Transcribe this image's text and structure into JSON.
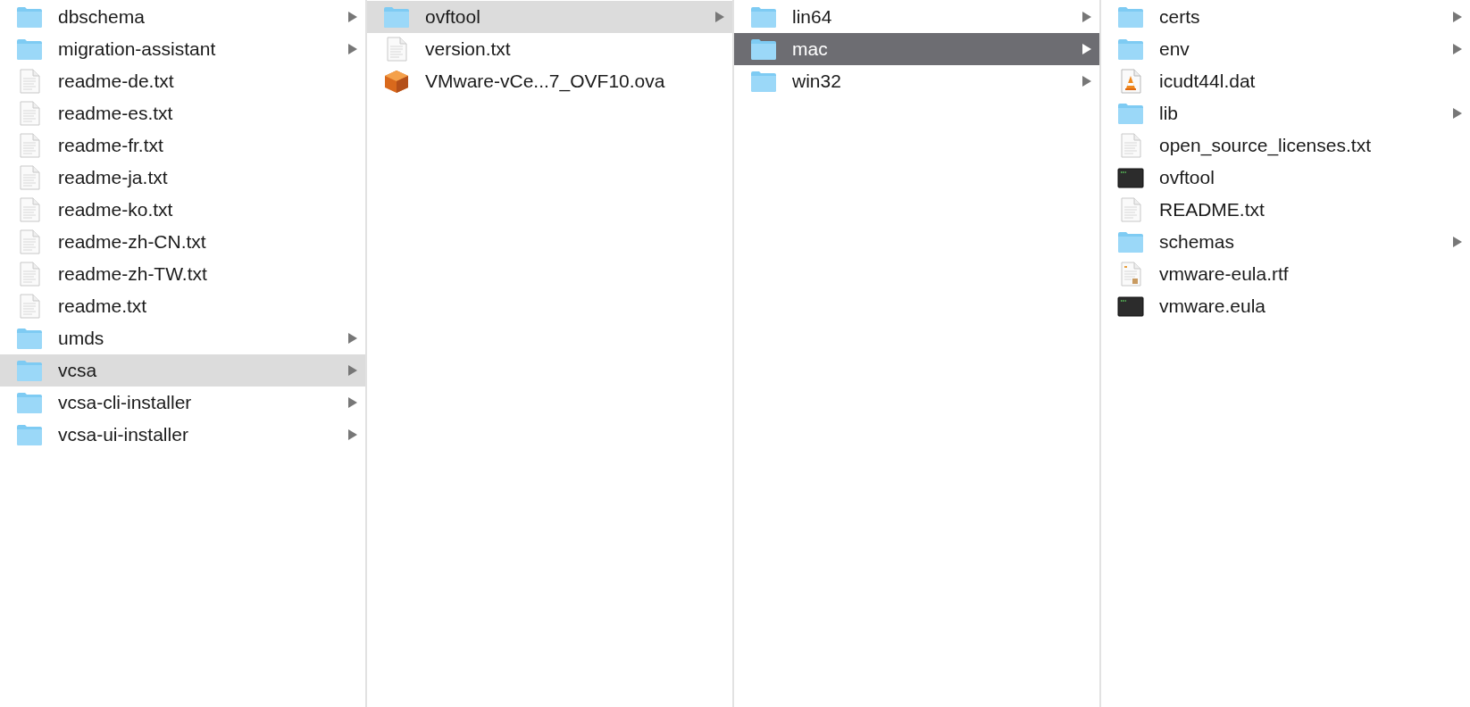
{
  "columns": [
    {
      "items": [
        {
          "name": "dbschema",
          "kind": "folder",
          "selected": false,
          "focused": false
        },
        {
          "name": "migration-assistant",
          "kind": "folder",
          "selected": false,
          "focused": false
        },
        {
          "name": "readme-de.txt",
          "kind": "text",
          "selected": false,
          "focused": false
        },
        {
          "name": "readme-es.txt",
          "kind": "text",
          "selected": false,
          "focused": false
        },
        {
          "name": "readme-fr.txt",
          "kind": "text",
          "selected": false,
          "focused": false
        },
        {
          "name": "readme-ja.txt",
          "kind": "text",
          "selected": false,
          "focused": false
        },
        {
          "name": "readme-ko.txt",
          "kind": "text",
          "selected": false,
          "focused": false
        },
        {
          "name": "readme-zh-CN.txt",
          "kind": "text",
          "selected": false,
          "focused": false
        },
        {
          "name": "readme-zh-TW.txt",
          "kind": "text",
          "selected": false,
          "focused": false
        },
        {
          "name": "readme.txt",
          "kind": "text",
          "selected": false,
          "focused": false
        },
        {
          "name": "umds",
          "kind": "folder",
          "selected": false,
          "focused": false
        },
        {
          "name": "vcsa",
          "kind": "folder",
          "selected": true,
          "focused": false
        },
        {
          "name": "vcsa-cli-installer",
          "kind": "folder",
          "selected": false,
          "focused": false
        },
        {
          "name": "vcsa-ui-installer",
          "kind": "folder",
          "selected": false,
          "focused": false
        }
      ]
    },
    {
      "items": [
        {
          "name": "ovftool",
          "kind": "folder",
          "selected": true,
          "focused": false
        },
        {
          "name": "version.txt",
          "kind": "text",
          "selected": false,
          "focused": false
        },
        {
          "name": "VMware-vCe...7_OVF10.ova",
          "kind": "package",
          "selected": false,
          "focused": false
        }
      ]
    },
    {
      "items": [
        {
          "name": "lin64",
          "kind": "folder",
          "selected": false,
          "focused": false
        },
        {
          "name": "mac",
          "kind": "folder",
          "selected": true,
          "focused": true
        },
        {
          "name": "win32",
          "kind": "folder",
          "selected": false,
          "focused": false
        }
      ]
    },
    {
      "items": [
        {
          "name": "certs",
          "kind": "folder",
          "selected": false,
          "focused": false
        },
        {
          "name": "env",
          "kind": "folder",
          "selected": false,
          "focused": false
        },
        {
          "name": "icudt44l.dat",
          "kind": "media",
          "selected": false,
          "focused": false
        },
        {
          "name": "lib",
          "kind": "folder",
          "selected": false,
          "focused": false
        },
        {
          "name": "open_source_licenses.txt",
          "kind": "text",
          "selected": false,
          "focused": false
        },
        {
          "name": "ovftool",
          "kind": "exec",
          "selected": false,
          "focused": false
        },
        {
          "name": "README.txt",
          "kind": "text",
          "selected": false,
          "focused": false
        },
        {
          "name": "schemas",
          "kind": "folder",
          "selected": false,
          "focused": false
        },
        {
          "name": "vmware-eula.rtf",
          "kind": "rtf",
          "selected": false,
          "focused": false
        },
        {
          "name": "vmware.eula",
          "kind": "exec",
          "selected": false,
          "focused": false
        }
      ]
    }
  ]
}
